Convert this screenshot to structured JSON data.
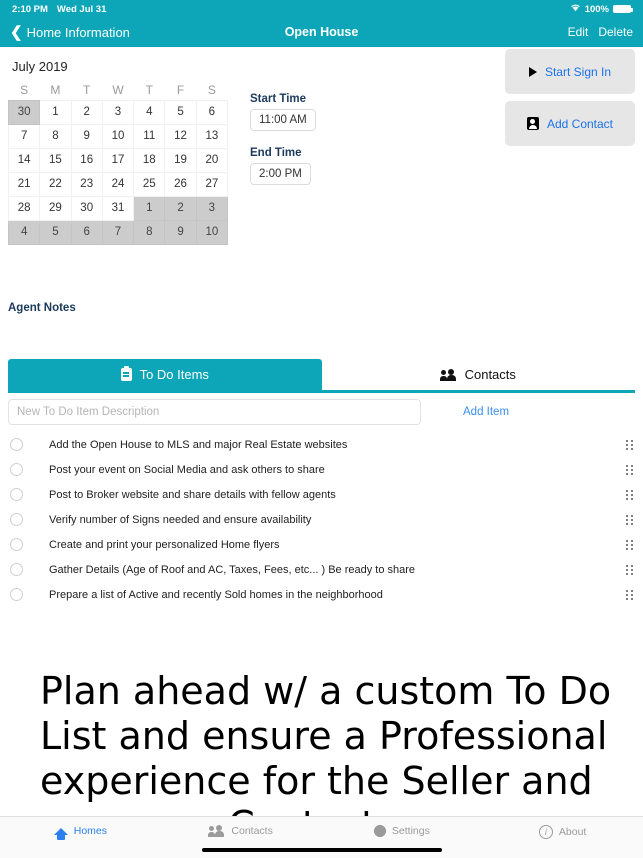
{
  "status_bar": {
    "time": "2:10 PM",
    "date": "Wed Jul 31",
    "battery_percent": "100%",
    "wifi_icon": "wifi-icon",
    "battery_icon": "battery-full-icon"
  },
  "nav_bar": {
    "back_label": "Home Information",
    "back_icon": "chevron-left-icon",
    "title": "Open House",
    "edit_label": "Edit",
    "delete_label": "Delete"
  },
  "calendar": {
    "month_title": "July 2019",
    "weekdays": [
      "S",
      "M",
      "T",
      "W",
      "T",
      "F",
      "S"
    ],
    "weeks": [
      [
        {
          "d": "30",
          "out": true
        },
        {
          "d": "1",
          "out": false
        },
        {
          "d": "2",
          "out": false
        },
        {
          "d": "3",
          "out": false
        },
        {
          "d": "4",
          "out": false
        },
        {
          "d": "5",
          "out": false
        },
        {
          "d": "6",
          "out": false
        }
      ],
      [
        {
          "d": "7",
          "out": false
        },
        {
          "d": "8",
          "out": false
        },
        {
          "d": "9",
          "out": false
        },
        {
          "d": "10",
          "out": false
        },
        {
          "d": "11",
          "out": false
        },
        {
          "d": "12",
          "out": false
        },
        {
          "d": "13",
          "out": false
        }
      ],
      [
        {
          "d": "14",
          "out": false
        },
        {
          "d": "15",
          "out": false
        },
        {
          "d": "16",
          "out": false
        },
        {
          "d": "17",
          "out": false
        },
        {
          "d": "18",
          "out": false
        },
        {
          "d": "19",
          "out": false
        },
        {
          "d": "20",
          "out": false
        }
      ],
      [
        {
          "d": "21",
          "out": false
        },
        {
          "d": "22",
          "out": false
        },
        {
          "d": "23",
          "out": false
        },
        {
          "d": "24",
          "out": false
        },
        {
          "d": "25",
          "out": false
        },
        {
          "d": "26",
          "out": false
        },
        {
          "d": "27",
          "out": false
        }
      ],
      [
        {
          "d": "28",
          "out": false
        },
        {
          "d": "29",
          "out": false
        },
        {
          "d": "30",
          "out": false
        },
        {
          "d": "31",
          "out": false
        },
        {
          "d": "1",
          "out": true
        },
        {
          "d": "2",
          "out": true
        },
        {
          "d": "3",
          "out": true
        }
      ],
      [
        {
          "d": "4",
          "out": true
        },
        {
          "d": "5",
          "out": true
        },
        {
          "d": "6",
          "out": true
        },
        {
          "d": "7",
          "out": true
        },
        {
          "d": "8",
          "out": true
        },
        {
          "d": "9",
          "out": true
        },
        {
          "d": "10",
          "out": true
        }
      ]
    ]
  },
  "times": {
    "start_label": "Start Time",
    "start_value": "11:00 AM",
    "end_label": "End Time",
    "end_value": "2:00 PM"
  },
  "side_actions": {
    "start_sign_in_label": "Start Sign In",
    "start_sign_in_icon": "play-triangle-icon",
    "add_contact_label": "Add Contact",
    "add_contact_icon": "contact-card-icon"
  },
  "agent_notes": {
    "label": "Agent Notes"
  },
  "tabs": {
    "todo_label": "To Do Items",
    "todo_icon": "clipboard-icon",
    "contacts_label": "Contacts",
    "contacts_icon": "people-icon"
  },
  "new_item": {
    "placeholder": "New To Do Item Description",
    "value": "",
    "add_label": "Add Item"
  },
  "todo_items": [
    "Add the Open House to MLS and major Real Estate websites",
    "Post your event on Social Media and ask others to share",
    "Post to Broker website and share details with fellow agents",
    "Verify number of Signs needed and ensure availability",
    "Create and print your personalized Home flyers",
    "Gather Details (Age of Roof and AC, Taxes, Fees, etc... ) Be ready to share",
    "Prepare a list of Active and recently Sold homes in the neighborhood"
  ],
  "hero": {
    "text": "Plan ahead w/ a custom To Do List and ensure a Professional experience for the Seller and your new Contacts"
  },
  "tab_bar": {
    "items": [
      {
        "label": "Homes",
        "icon": "home-icon",
        "active": true
      },
      {
        "label": "Contacts",
        "icon": "people-icon",
        "active": false
      },
      {
        "label": "Settings",
        "icon": "gear-icon",
        "active": false
      },
      {
        "label": "About",
        "icon": "info-icon",
        "active": false
      }
    ]
  },
  "colors": {
    "accent_teal": "#0CA6B8",
    "link_blue": "#1a73e8",
    "active_tab_blue": "#2d7ff0",
    "navy_label": "#1b3a5c",
    "disabled_day": "#cccccc"
  }
}
